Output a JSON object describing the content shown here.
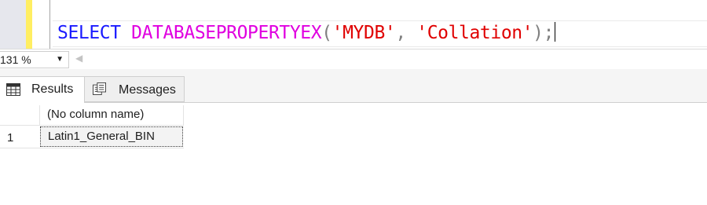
{
  "editor": {
    "tokens": {
      "keyword": "SELECT",
      "function": "DATABASEPROPERTYEX",
      "open_paren": "(",
      "arg1": "'MYDB'",
      "comma": ",",
      "arg2": "'Collation'",
      "close_paren": ");"
    }
  },
  "zoom": {
    "value": "131 %"
  },
  "results": {
    "tabs": [
      {
        "label": "Results",
        "icon": "grid-icon",
        "active": true
      },
      {
        "label": "Messages",
        "icon": "messages-icon",
        "active": false
      }
    ],
    "grid": {
      "columns": [
        "(No column name)"
      ],
      "rows": [
        {
          "row_number": "1",
          "cells": [
            "Latin1_General_BIN"
          ]
        }
      ]
    }
  },
  "colors": {
    "keyword": "#1a1aff",
    "function": "#e000e0",
    "string": "#e00000",
    "change_bar": "#ffee62"
  }
}
